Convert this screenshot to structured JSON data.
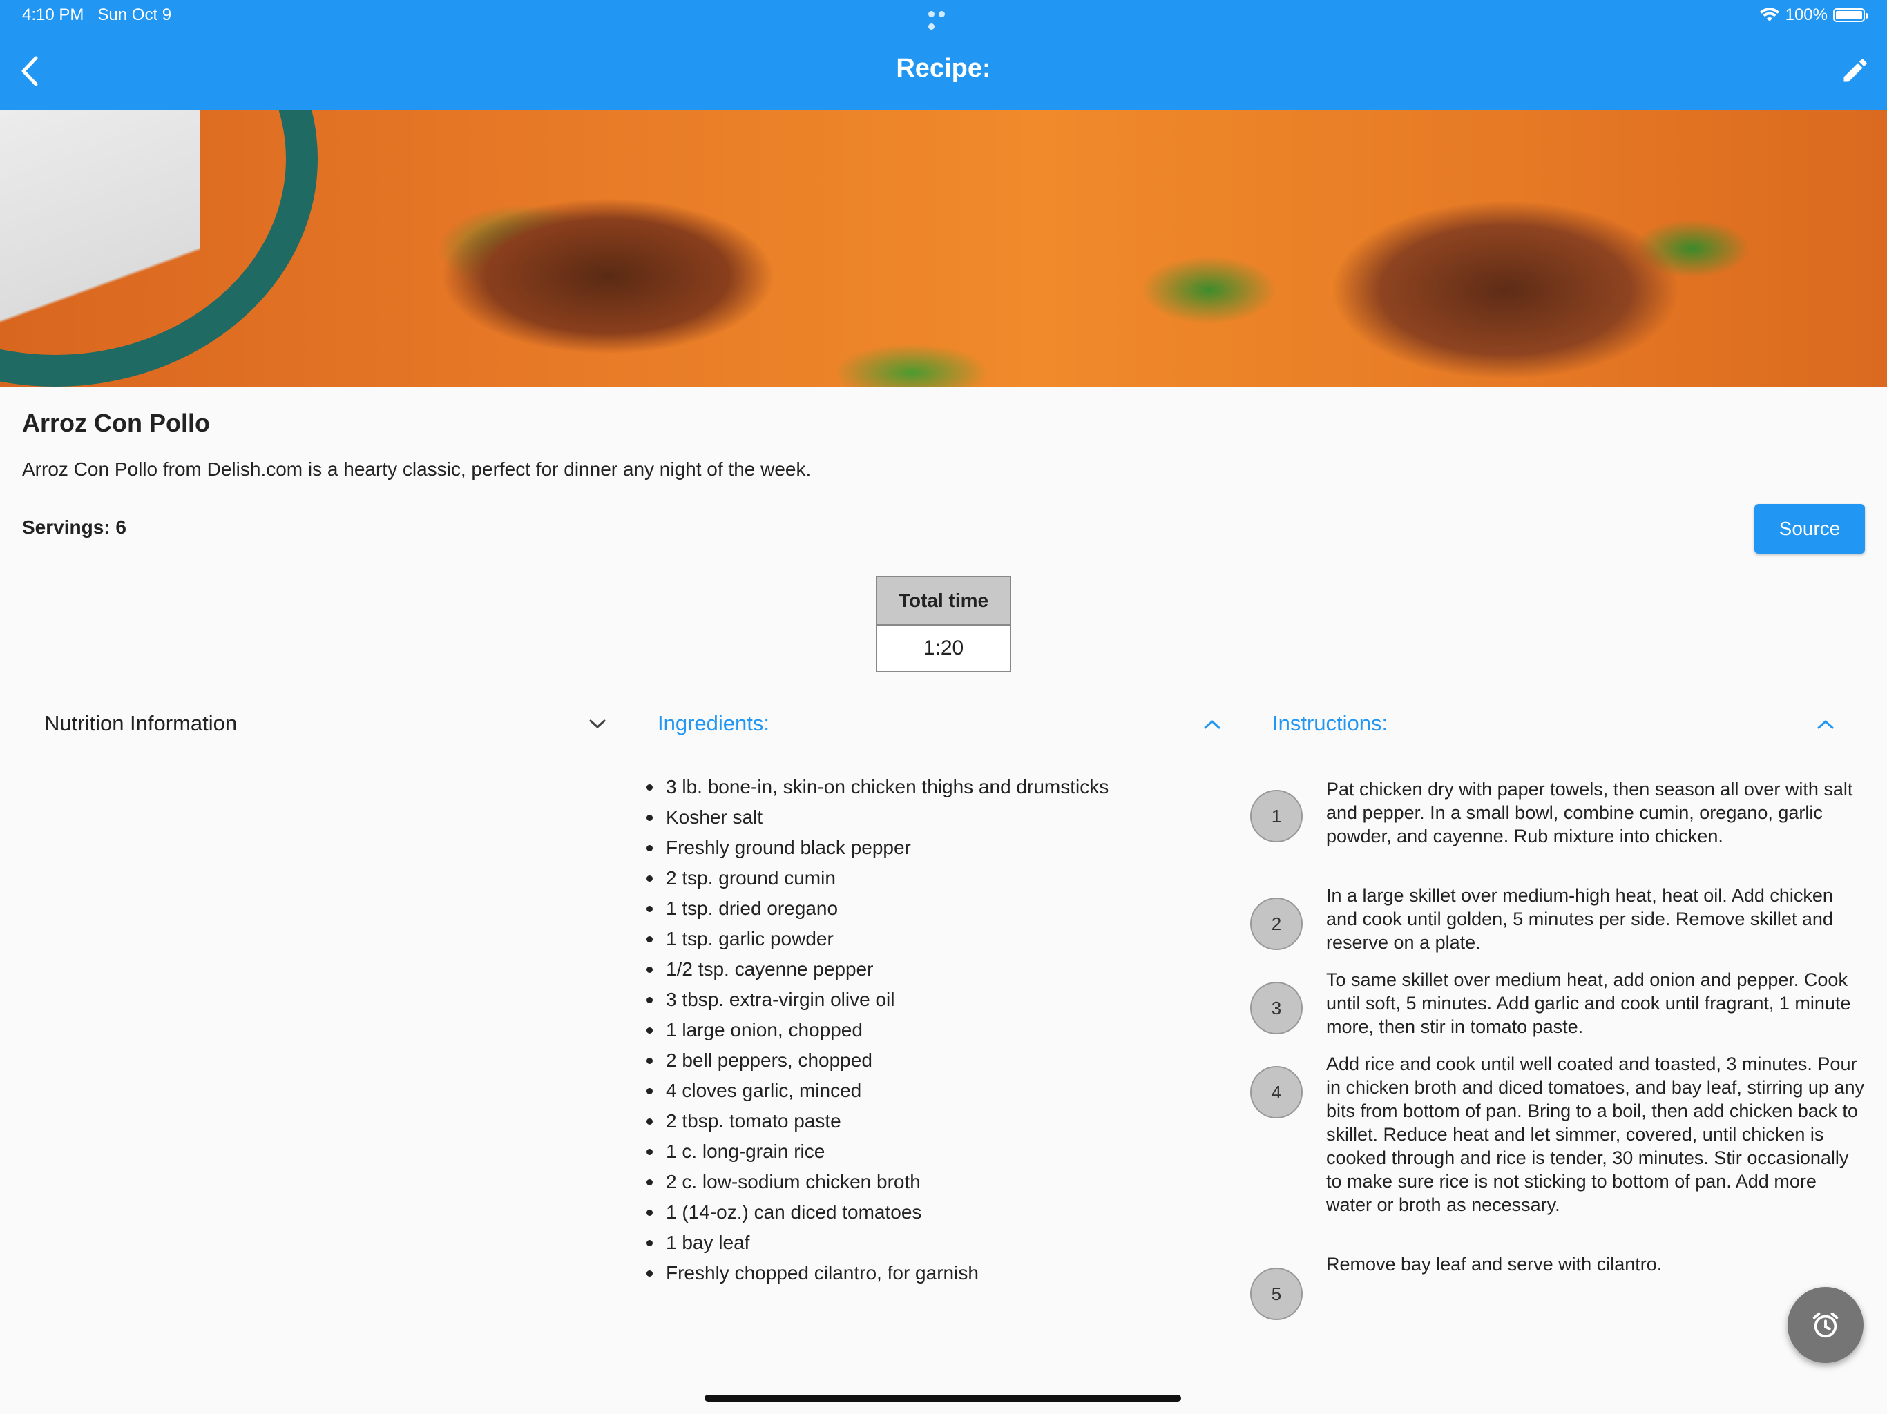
{
  "status_bar": {
    "time": "4:10 PM",
    "date": "Sun Oct 9",
    "battery": "100%"
  },
  "app_bar": {
    "title": "Recipe:",
    "back_icon": "chevron-left-icon",
    "edit_icon": "pencil-icon"
  },
  "recipe": {
    "name": "Arroz Con Pollo",
    "description": "Arroz Con Pollo from Delish.com is a hearty classic, perfect for dinner any night of the week.",
    "servings": "Servings: 6",
    "source_label": "Source",
    "total_time_label": "Total time",
    "total_time_value": "1:20"
  },
  "sections": {
    "nutrition": "Nutrition Information",
    "ingredients": "Ingredients:",
    "instructions": "Instructions:"
  },
  "ingredients": [
    "3 lb. bone-in, skin-on chicken thighs and drumsticks",
    "Kosher salt",
    "Freshly ground black pepper",
    "2 tsp. ground cumin",
    "1 tsp. dried oregano",
    "1 tsp. garlic powder",
    "1/2 tsp. cayenne pepper",
    "3 tbsp. extra-virgin olive oil",
    "1 large onion, chopped",
    "2 bell peppers, chopped",
    "4 cloves garlic, minced",
    "2 tbsp. tomato paste",
    "1 c. long-grain rice",
    "2 c. low-sodium chicken broth",
    "1 (14-oz.) can diced tomatoes",
    "1 bay leaf",
    "Freshly chopped cilantro, for garnish"
  ],
  "instructions": [
    {
      "num": "1",
      "text": "Pat chicken dry with paper towels, then season all over with salt and pepper. In a small bowl, combine cumin, oregano, garlic powder, and cayenne. Rub mixture into chicken."
    },
    {
      "num": "2",
      "text": "In a large skillet over medium-high heat, heat oil. Add chicken and cook until golden, 5 minutes per side. Remove skillet and reserve on a plate."
    },
    {
      "num": "3",
      "text": "To same skillet over medium heat, add onion and pepper. Cook until soft, 5 minutes. Add garlic and cook until fragrant, 1 minute more, then stir in tomato paste."
    },
    {
      "num": "4",
      "text": "Add rice and cook until well coated and toasted, 3 minutes. Pour in chicken broth and diced tomatoes, and bay leaf, stirring up any bits from bottom of pan. Bring to a boil, then add chicken back to skillet. Reduce heat and let simmer, covered, until chicken is cooked through and rice is tender, 30 minutes. Stir occasionally to make sure rice is not sticking to bottom of pan. Add more water or broth as necessary."
    },
    {
      "num": "5",
      "text": "Remove bay leaf and serve with cilantro."
    }
  ],
  "fab_icon": "alarm-clock-icon",
  "colors": {
    "accent": "#2196f3",
    "fab": "#757575"
  }
}
